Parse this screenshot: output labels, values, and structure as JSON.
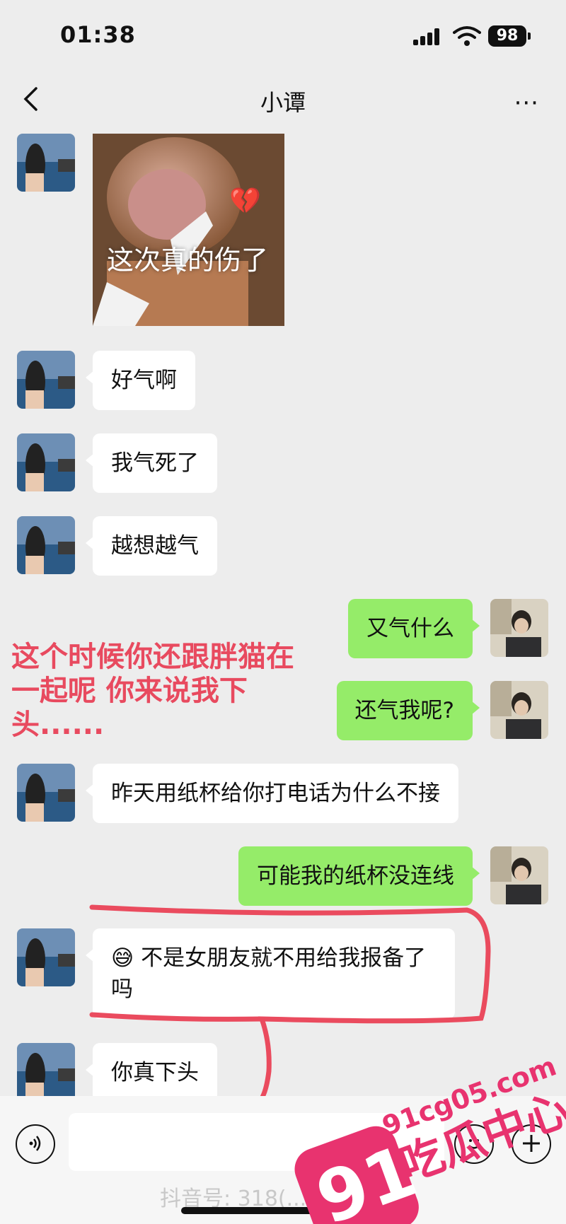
{
  "status_bar": {
    "time": "01:38",
    "battery": "98"
  },
  "nav": {
    "title": "小谭",
    "more": "···",
    "back": "‹"
  },
  "sticker": {
    "caption": "这次真的伤了"
  },
  "messages": [
    {
      "side": "left",
      "text": "好气啊"
    },
    {
      "side": "left",
      "text": "我气死了"
    },
    {
      "side": "left",
      "text": "越想越气"
    },
    {
      "side": "right",
      "text": "又气什么"
    },
    {
      "side": "right",
      "text": "还气我呢?"
    },
    {
      "side": "left",
      "text": "昨天用纸杯给你打电话为什么不接"
    },
    {
      "side": "right",
      "text": "可能我的纸杯没连线"
    },
    {
      "side": "left",
      "text": "😅 不是女朋友就不用给我报备了吗"
    },
    {
      "side": "left",
      "text": "你真下头"
    }
  ],
  "annotation": {
    "line1": "这个时候你还跟胖猫在",
    "line2": "一起呢 你来说我下头......"
  },
  "input_bar": {
    "watermark": "抖音号: 318(...)87"
  },
  "logo": {
    "number": "91",
    "text": "吃瓜中心",
    "url": "91cg05.com"
  },
  "colors": {
    "sent_bubble": "#95ec69",
    "received_bubble": "#ffffff",
    "annotation": "#e84a5f",
    "logo": "#e8336f"
  },
  "icons": {
    "voice": "voice-icon",
    "emoji": "emoji-icon",
    "plus": "plus-icon"
  }
}
